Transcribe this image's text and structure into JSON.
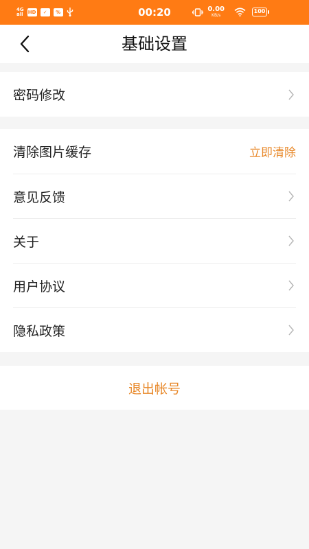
{
  "status_bar": {
    "network": "4G",
    "signal": "all",
    "hd": "HD",
    "time": "00:20",
    "speed_value": "0.00",
    "speed_unit": "KB/s",
    "battery": "100",
    "icons": [
      "signal-icon",
      "hd-icon",
      "mail-icon",
      "volte-icon",
      "usb-icon",
      "vibrate-icon",
      "wifi-icon"
    ],
    "background": "#ff7b14"
  },
  "nav": {
    "title": "基础设置",
    "back_icon": "chevron-left-icon"
  },
  "groups": [
    {
      "items": [
        {
          "label": "密码修改",
          "trailing": "chevron"
        }
      ]
    },
    {
      "items": [
        {
          "label": "清除图片缓存",
          "action": "立即清除"
        },
        {
          "label": "意见反馈",
          "trailing": "chevron"
        },
        {
          "label": "关于",
          "trailing": "chevron"
        },
        {
          "label": "用户协议",
          "trailing": "chevron"
        },
        {
          "label": "隐私政策",
          "trailing": "chevron"
        }
      ]
    }
  ],
  "logout": {
    "label": "退出帐号"
  },
  "colors": {
    "accent": "#e8892b",
    "status_bar": "#ff7b14",
    "background": "#f5f5f5",
    "divider": "#ececec"
  }
}
